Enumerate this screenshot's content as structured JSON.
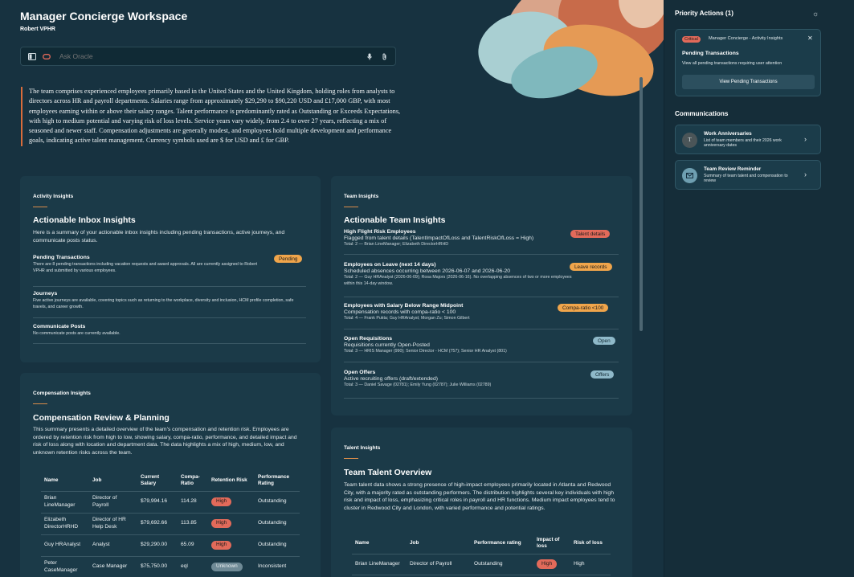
{
  "header": {
    "title": "Manager Concierge Workspace",
    "user": "Robert VPHR"
  },
  "ask": {
    "placeholder": "Ask Oracle"
  },
  "summary": "The team comprises experienced employees primarily based in the United States and the United Kingdom, holding roles from analysts to directors across HR and payroll departments. Salaries range from approximately $29,290 to $90,220 USD and £17,000 GBP, with most employees earning within or above their salary ranges. Talent performance is predominantly rated as Outstanding or Exceeds Expectations, with high to medium potential and varying risk of loss levels. Service years vary widely, from 2.4 to over 27 years, reflecting a mix of seasoned and newer staff. Compensation adjustments are generally modest, and employees hold multiple development and performance goals, indicating active talent management. Currency symbols used are $ for USD and £ for GBP.",
  "activity": {
    "kicker": "Activity Insights",
    "title": "Actionable Inbox Insights",
    "desc": "Here is a summary of your actionable inbox insights including pending transactions, active journeys, and communicate posts status.",
    "items": [
      {
        "title": "Pending Transactions",
        "text": "There are 8 pending transactions including vacation requests and award approvals. All are currently assigned to Robert VPHR and submitted by various employees.",
        "badge": "Pending"
      },
      {
        "title": "Journeys",
        "text": "Five active journeys are available, covering topics such as returning to the workplace, diversity and inclusion, HCM profile completion, safe travels, and career growth.",
        "badge": ""
      },
      {
        "title": "Communicate Posts",
        "text": "No communicate posts are currently available.",
        "badge": ""
      }
    ]
  },
  "team": {
    "kicker": "Team Insights",
    "title": "Actionable Team Insights",
    "items": [
      {
        "title": "High Flight Risk Employees",
        "sub": "Flagged from talent details (TalentImpactOfLoss and TalentRiskOfLoss = High)",
        "text": "Total: 2 — Brian LineManager; Elizabeth DirectorHRHD",
        "badge": "Talent details"
      },
      {
        "title": "Employees on Leave (next 14 days)",
        "sub": "Scheduled absences occurring between 2026-06-07 and 2026-06-20",
        "text": "Total: 2 — Guy HRAnalyst (2026-06-09); Rosa Majors (2026-06-16). No overlapping absences of two or more employees within this 14-day window.",
        "badge": "Leave records"
      },
      {
        "title": "Employees with Salary Below Range Midpoint",
        "sub": "Compensation records with compa-ratio < 100",
        "text": "Total: 4 — Frank Pukta; Guy HRAnalyst; Morgan Zu; Simon Gilbert",
        "badge": "Compa-ratio <100"
      },
      {
        "title": "Open Requisitions",
        "sub": "Requisitions currently Open-Posted",
        "text": "Total: 3 — HRIS Manager (990); Senior Director - HCM (757); Senior HR Analyst (801)",
        "badge": "Open"
      },
      {
        "title": "Open Offers",
        "sub": "Active recruiting offers (draft/extended)",
        "text": "Total: 3 — Daniel Savage (02781); Emily Yung (02787); Julie Williams (02789)",
        "badge": "Offers"
      }
    ]
  },
  "compensation": {
    "kicker": "Compensation Insights",
    "title": "Compensation Review & Planning",
    "desc": "This summary presents a detailed overview of the team's compensation and retention risk. Employees are ordered by retention risk from high to low, showing salary, compa-ratio, performance, and detailed impact and risk of loss along with location and department data. The data highlights a mix of high, medium, low, and unknown retention risks across the team.",
    "columns": [
      "Name",
      "Job",
      "Current Salary",
      "Compa-Ratio",
      "Retention Risk",
      "Performance Rating"
    ],
    "rows": [
      {
        "name": "Brian LineManager",
        "job": "Director of Payroll",
        "salary": "$79,994.16",
        "ratio": "114.28",
        "risk": "High",
        "rating": "Outstanding"
      },
      {
        "name": "Elizabeth DirectorHRHD",
        "job": "Director of HR Help Desk",
        "salary": "$79,692.66",
        "ratio": "113.85",
        "risk": "High",
        "rating": "Outstanding"
      },
      {
        "name": "Guy HRAnalyst",
        "job": "Analyst",
        "salary": "$29,290.00",
        "ratio": "65.09",
        "risk": "High",
        "rating": "Outstanding"
      },
      {
        "name": "Peter CaseManager",
        "job": "Case Manager",
        "salary": "$75,750.00",
        "ratio": "eql",
        "risk": "Unknown",
        "rating": "Inconsistent"
      }
    ]
  },
  "talent": {
    "kicker": "Talent Insights",
    "title": "Team Talent Overview",
    "desc": "Team talent data shows a strong presence of high-impact employees primarily located in Atlanta and Redwood City, with a majority rated as outstanding performers. The distribution highlights several key individuals with high risk and impact of loss, emphasizing critical roles in payroll and HR functions. Medium impact employees tend to cluster in Redwood City and London, with varied performance and potential ratings.",
    "columns": [
      "Name",
      "Job",
      "Performance rating",
      "Impact of loss",
      "Risk of loss"
    ],
    "rows": [
      {
        "name": "Brian LineManager",
        "job": "Director of Payroll",
        "rating": "Outstanding",
        "impact": "High",
        "risk": "High"
      }
    ]
  },
  "priority": {
    "title": "Priority Actions (1)",
    "badge": "Critical",
    "source": "Manager Concierge - Activity Insights",
    "card_title": "Pending Transactions",
    "card_desc": "View all pending transactions requiring user attention",
    "button": "View Pending Transactions"
  },
  "communications": {
    "title": "Communications",
    "items": [
      {
        "avatar": "T",
        "title": "Work Anniversaries",
        "desc": "List of team members and their 2026 work anniversary dates"
      },
      {
        "avatar": "",
        "title": "Team Review Reminder",
        "desc": "Summary of team talent and compensation to review"
      }
    ]
  },
  "colors": {
    "background": "#173240",
    "card": "#1b3a48",
    "accent_orange": "#f0a54b",
    "risk_high": "#e26a5a",
    "badge_blue": "#8fb9c9"
  }
}
